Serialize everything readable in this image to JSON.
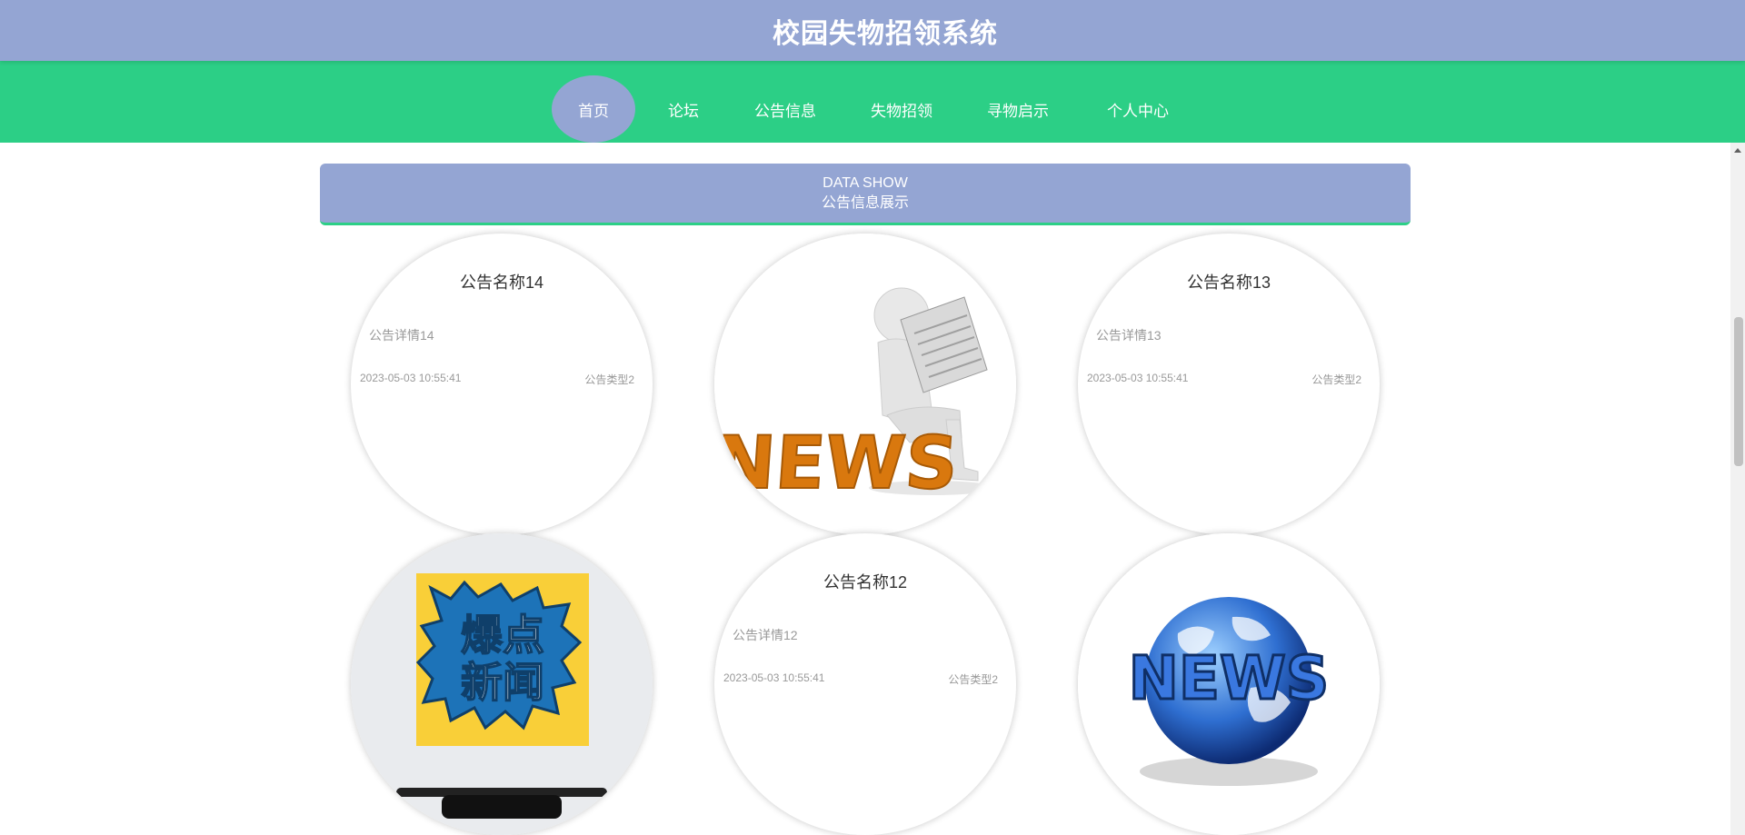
{
  "header": {
    "title": "校园失物招领系统"
  },
  "nav": {
    "items": [
      {
        "label": "首页",
        "active": true
      },
      {
        "label": "论坛"
      },
      {
        "label": "公告信息"
      },
      {
        "label": "失物招领"
      },
      {
        "label": "寻物启示"
      },
      {
        "label": "个人中心"
      }
    ]
  },
  "section": {
    "title_en": "DATA SHOW",
    "title_cn": "公告信息展示"
  },
  "notices": [
    {
      "title": "公告名称14",
      "detail": "公告详情14",
      "date": "2023-05-03 10:55:41",
      "type": "公告类型2"
    },
    {
      "image": "news-reading-man-image"
    },
    {
      "title": "公告名称13",
      "detail": "公告详情13",
      "date": "2023-05-03 10:55:41",
      "type": "公告类型2"
    },
    {
      "image": "breaking-news-poster-image",
      "image_text_line1": "爆点",
      "image_text_line2": "新闻"
    },
    {
      "title": "公告名称12",
      "detail": "公告详情12",
      "date": "2023-05-03 10:55:41",
      "type": "公告类型2"
    },
    {
      "image": "news-globe-image",
      "image_text": "NEWS"
    }
  ],
  "colors": {
    "header_bg": "#94a5d3",
    "nav_bg": "#2ccf86",
    "active_nav_bg": "#94a5d3"
  }
}
